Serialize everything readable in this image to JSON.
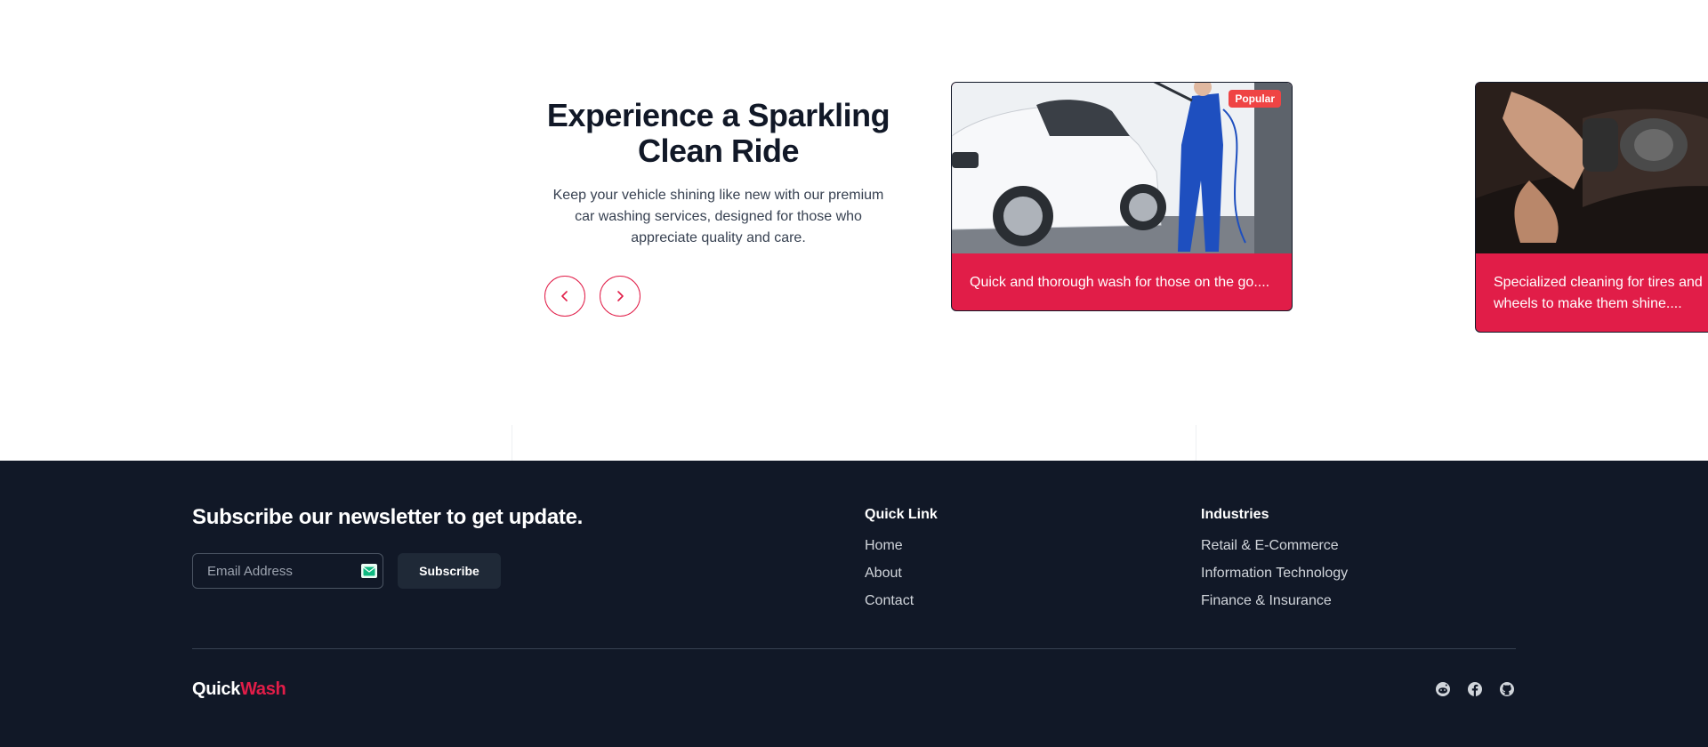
{
  "hero": {
    "title": "Experience a Sparkling Clean Ride",
    "description": "Keep your vehicle shining like new with our premium car washing services, designed for those who appreciate quality and care."
  },
  "carousel": {
    "prev_icon": "chevron-left-icon",
    "next_icon": "chevron-right-icon",
    "cards": [
      {
        "badge": "Popular",
        "text": "Quick and thorough wash for those on the go....",
        "image": "car-wash-photo"
      },
      {
        "text": "Specialized cleaning for tires and wheels to make them shine....",
        "image": "car-polishing-photo"
      }
    ]
  },
  "footer": {
    "newsletter_title": "Subscribe our newsletter to get update.",
    "email_placeholder": "Email Address",
    "subscribe_label": "Subscribe",
    "quick_link": {
      "title": "Quick Link",
      "items": [
        "Home",
        "About",
        "Contact"
      ]
    },
    "industries": {
      "title": "Industries",
      "items": [
        "Retail & E-Commerce",
        "Information Technology",
        "Finance & Insurance"
      ]
    },
    "brand": {
      "part1": "Quick",
      "part2": "Wash"
    },
    "social_icons": [
      "reddit-icon",
      "facebook-icon",
      "github-icon"
    ]
  },
  "colors": {
    "accent": "#e11d48",
    "footer_bg": "#111827",
    "badge": "#ef4444"
  }
}
